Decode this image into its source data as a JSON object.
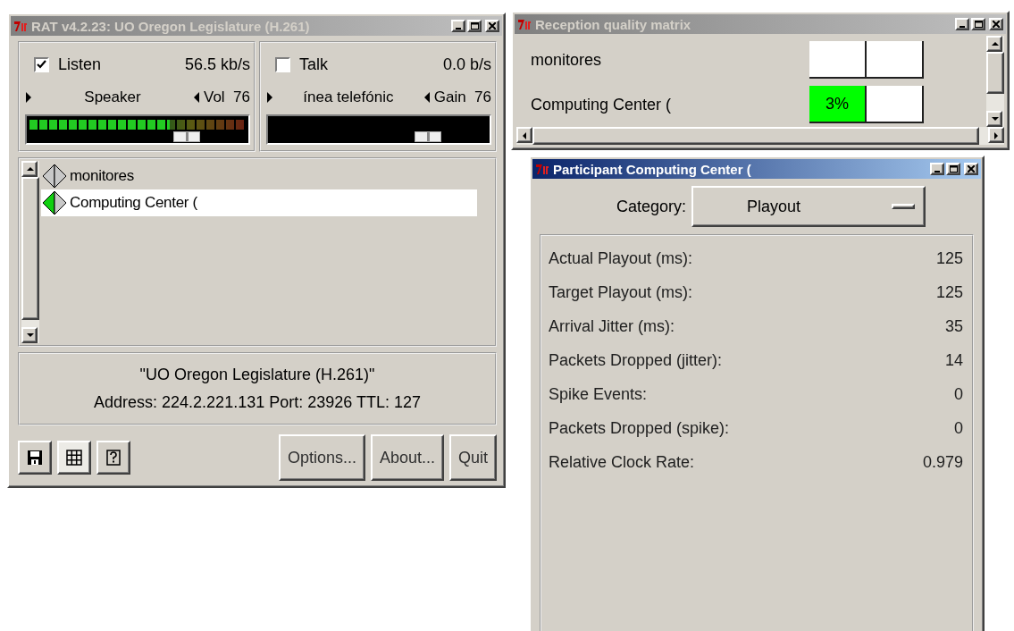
{
  "main_window": {
    "title": "RAT v4.2.23: UO Oregon Legislature (H.261)",
    "active": false,
    "channels": [
      {
        "label": "Listen",
        "checked": true,
        "rate": "56.5 kb/s",
        "device": "Speaker",
        "control": "Vol",
        "value": "76",
        "meter": {
          "level": 0.65
        },
        "slider": {
          "level": 0.76
        }
      },
      {
        "label": "Talk",
        "checked": false,
        "rate": "0.0 b/s",
        "device": "ínea telefónic",
        "control": "Gain",
        "value": "76",
        "slider": {
          "level": 0.76
        }
      }
    ],
    "participants": [
      {
        "name": "monitores",
        "selected": false,
        "receiving": false
      },
      {
        "name": "Computing Center (",
        "selected": true,
        "receiving": true
      }
    ],
    "session": {
      "name": "\"UO Oregon Legislature (H.261)\"",
      "address": "Address: 224.2.221.131 Port: 23926 TTL: 127"
    },
    "tool_buttons": [
      {
        "kind": "save",
        "pressed": false
      },
      {
        "kind": "grid",
        "pressed": true
      },
      {
        "kind": "help",
        "pressed": false
      }
    ],
    "buttons": [
      "Options...",
      "About...",
      "Quit"
    ]
  },
  "matrix_window": {
    "title": "Reception quality matrix",
    "active": false,
    "rows": [
      {
        "name": "monitores",
        "cells": [
          {
            "color": "#ffffff"
          },
          {
            "color": "#ffffff"
          }
        ]
      },
      {
        "name": "Computing Center (",
        "cells": [
          {
            "text": "3%",
            "color": "#00ff00"
          },
          {
            "color": "#ffffff"
          }
        ]
      }
    ]
  },
  "participant_window": {
    "title": "Participant Computing Center (",
    "active": true,
    "category_label": "Category:",
    "category": "Playout",
    "stats": [
      {
        "label": "Actual Playout (ms):",
        "value": "125"
      },
      {
        "label": "Target Playout (ms):",
        "value": "125"
      },
      {
        "label": "Arrival Jitter (ms):",
        "value": "35"
      },
      {
        "label": "Packets Dropped (jitter):",
        "value": "14"
      },
      {
        "label": "Spike Events:",
        "value": "0"
      },
      {
        "label": "Packets Dropped (spike):",
        "value": "0"
      },
      {
        "label": "Relative Clock Rate:",
        "value": "0.979"
      }
    ]
  }
}
